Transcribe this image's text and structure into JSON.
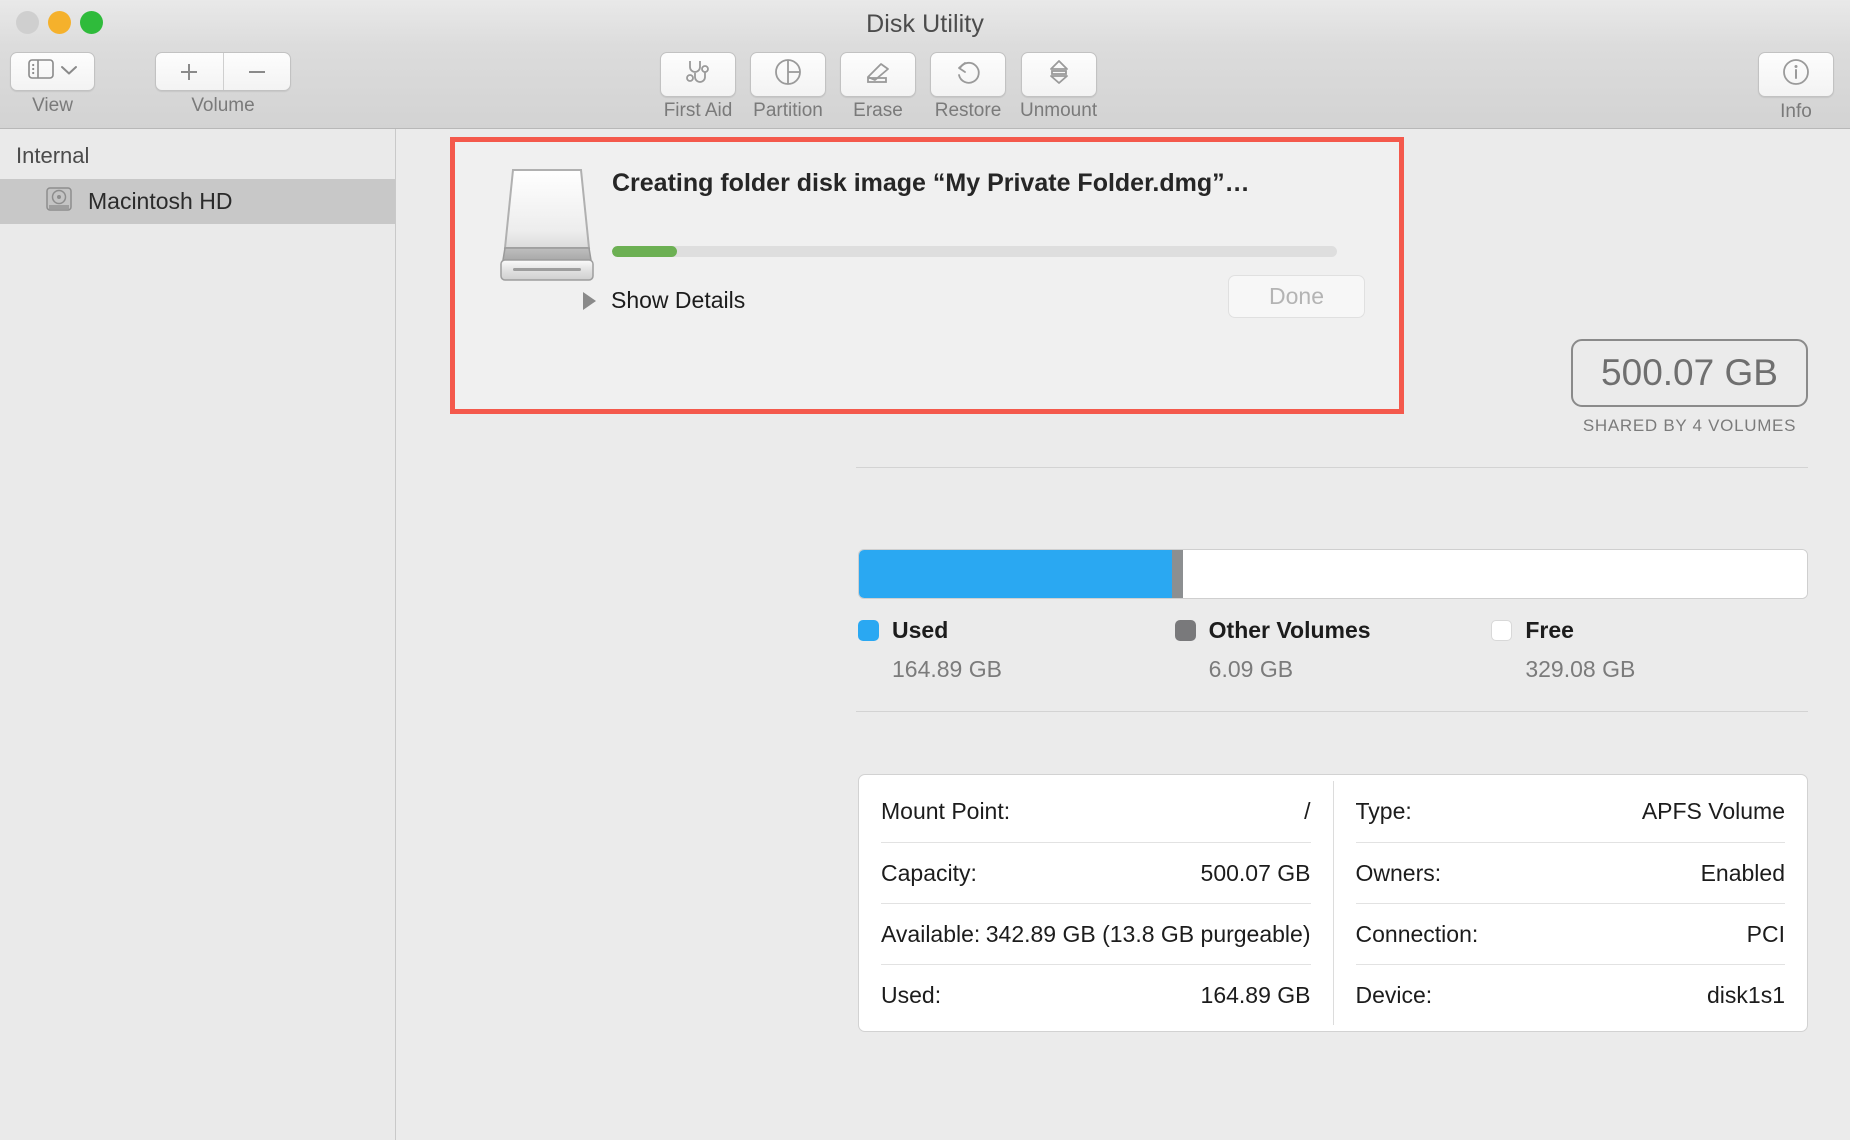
{
  "window": {
    "title": "Disk Utility",
    "traffic_lights": [
      "close",
      "minimize",
      "maximize"
    ]
  },
  "toolbar": {
    "view": {
      "label": "View",
      "icon": "sidebar-icon",
      "chevron": "chevron-down-icon"
    },
    "volume": {
      "label": "Volume",
      "add": "+",
      "remove": "−"
    },
    "tools": [
      {
        "label": "First Aid",
        "icon": "stethoscope-icon"
      },
      {
        "label": "Partition",
        "icon": "pie-chart-icon"
      },
      {
        "label": "Erase",
        "icon": "eraser-icon"
      },
      {
        "label": "Restore",
        "icon": "restore-arrow-icon"
      },
      {
        "label": "Unmount",
        "icon": "eject-icon"
      }
    ],
    "info": {
      "label": "Info",
      "icon": "info-circle-icon"
    }
  },
  "sidebar": {
    "header": "Internal",
    "items": [
      {
        "label": "Macintosh HD",
        "icon": "hard-drive-icon",
        "selected": true
      }
    ]
  },
  "dialog": {
    "title": "Creating folder disk image “My Private Folder.dmg”…",
    "icon": "disk-image-icon",
    "progress_percent": 9,
    "show_details_label": "Show Details",
    "disclosure_icon": "disclosure-triangle-icon",
    "done_label": "Done",
    "done_enabled": false,
    "highlight_color": "#f4594c"
  },
  "capacity": {
    "total": "500.07 GB",
    "subtitle": "SHARED BY 4 VOLUMES"
  },
  "storage": {
    "segments": [
      {
        "name": "Used",
        "value": "164.89 GB",
        "color": "#2aa8f2",
        "percent": 33.0
      },
      {
        "name": "Other Volumes",
        "value": "6.09 GB",
        "color": "#8c8f91",
        "percent": 1.2
      },
      {
        "name": "Free",
        "value": "329.08 GB",
        "color": "#ffffff",
        "percent": 65.8
      }
    ]
  },
  "info_table": {
    "left": [
      {
        "key": "Mount Point:",
        "value": "/"
      },
      {
        "key": "Capacity:",
        "value": "500.07 GB"
      },
      {
        "key": "Available:",
        "value": "342.89 GB (13.8 GB purgeable)"
      },
      {
        "key": "Used:",
        "value": "164.89 GB"
      }
    ],
    "right": [
      {
        "key": "Type:",
        "value": "APFS Volume"
      },
      {
        "key": "Owners:",
        "value": "Enabled"
      },
      {
        "key": "Connection:",
        "value": "PCI"
      },
      {
        "key": "Device:",
        "value": "disk1s1"
      }
    ]
  }
}
